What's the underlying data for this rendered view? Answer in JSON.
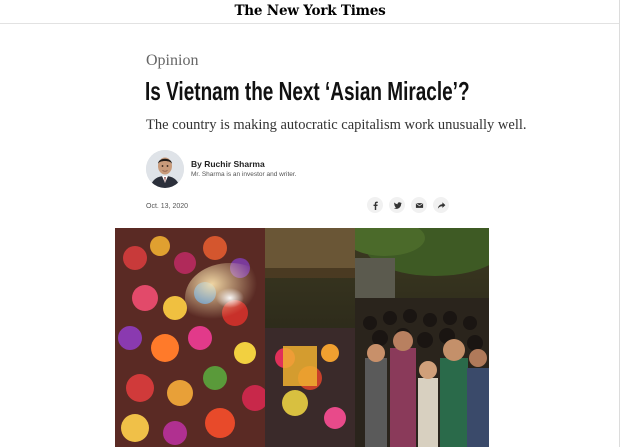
{
  "masthead": {
    "logo": "The New York Times"
  },
  "article": {
    "kicker": "Opinion",
    "headline": "Is Vietnam the Next ‘Asian Miracle’?",
    "summary": "The country is making autocratic capitalism work unusually well.",
    "byline": "By Ruchir Sharma",
    "author_bio": "Mr. Sharma is an investor and writer.",
    "date": "Oct. 13, 2020"
  },
  "share": {
    "icons": [
      "facebook-icon",
      "twitter-icon",
      "email-icon",
      "share-arrow-icon"
    ]
  },
  "colors": {
    "text": "#121212",
    "kicker": "#666666",
    "share_bg": "#f1f1f1"
  }
}
